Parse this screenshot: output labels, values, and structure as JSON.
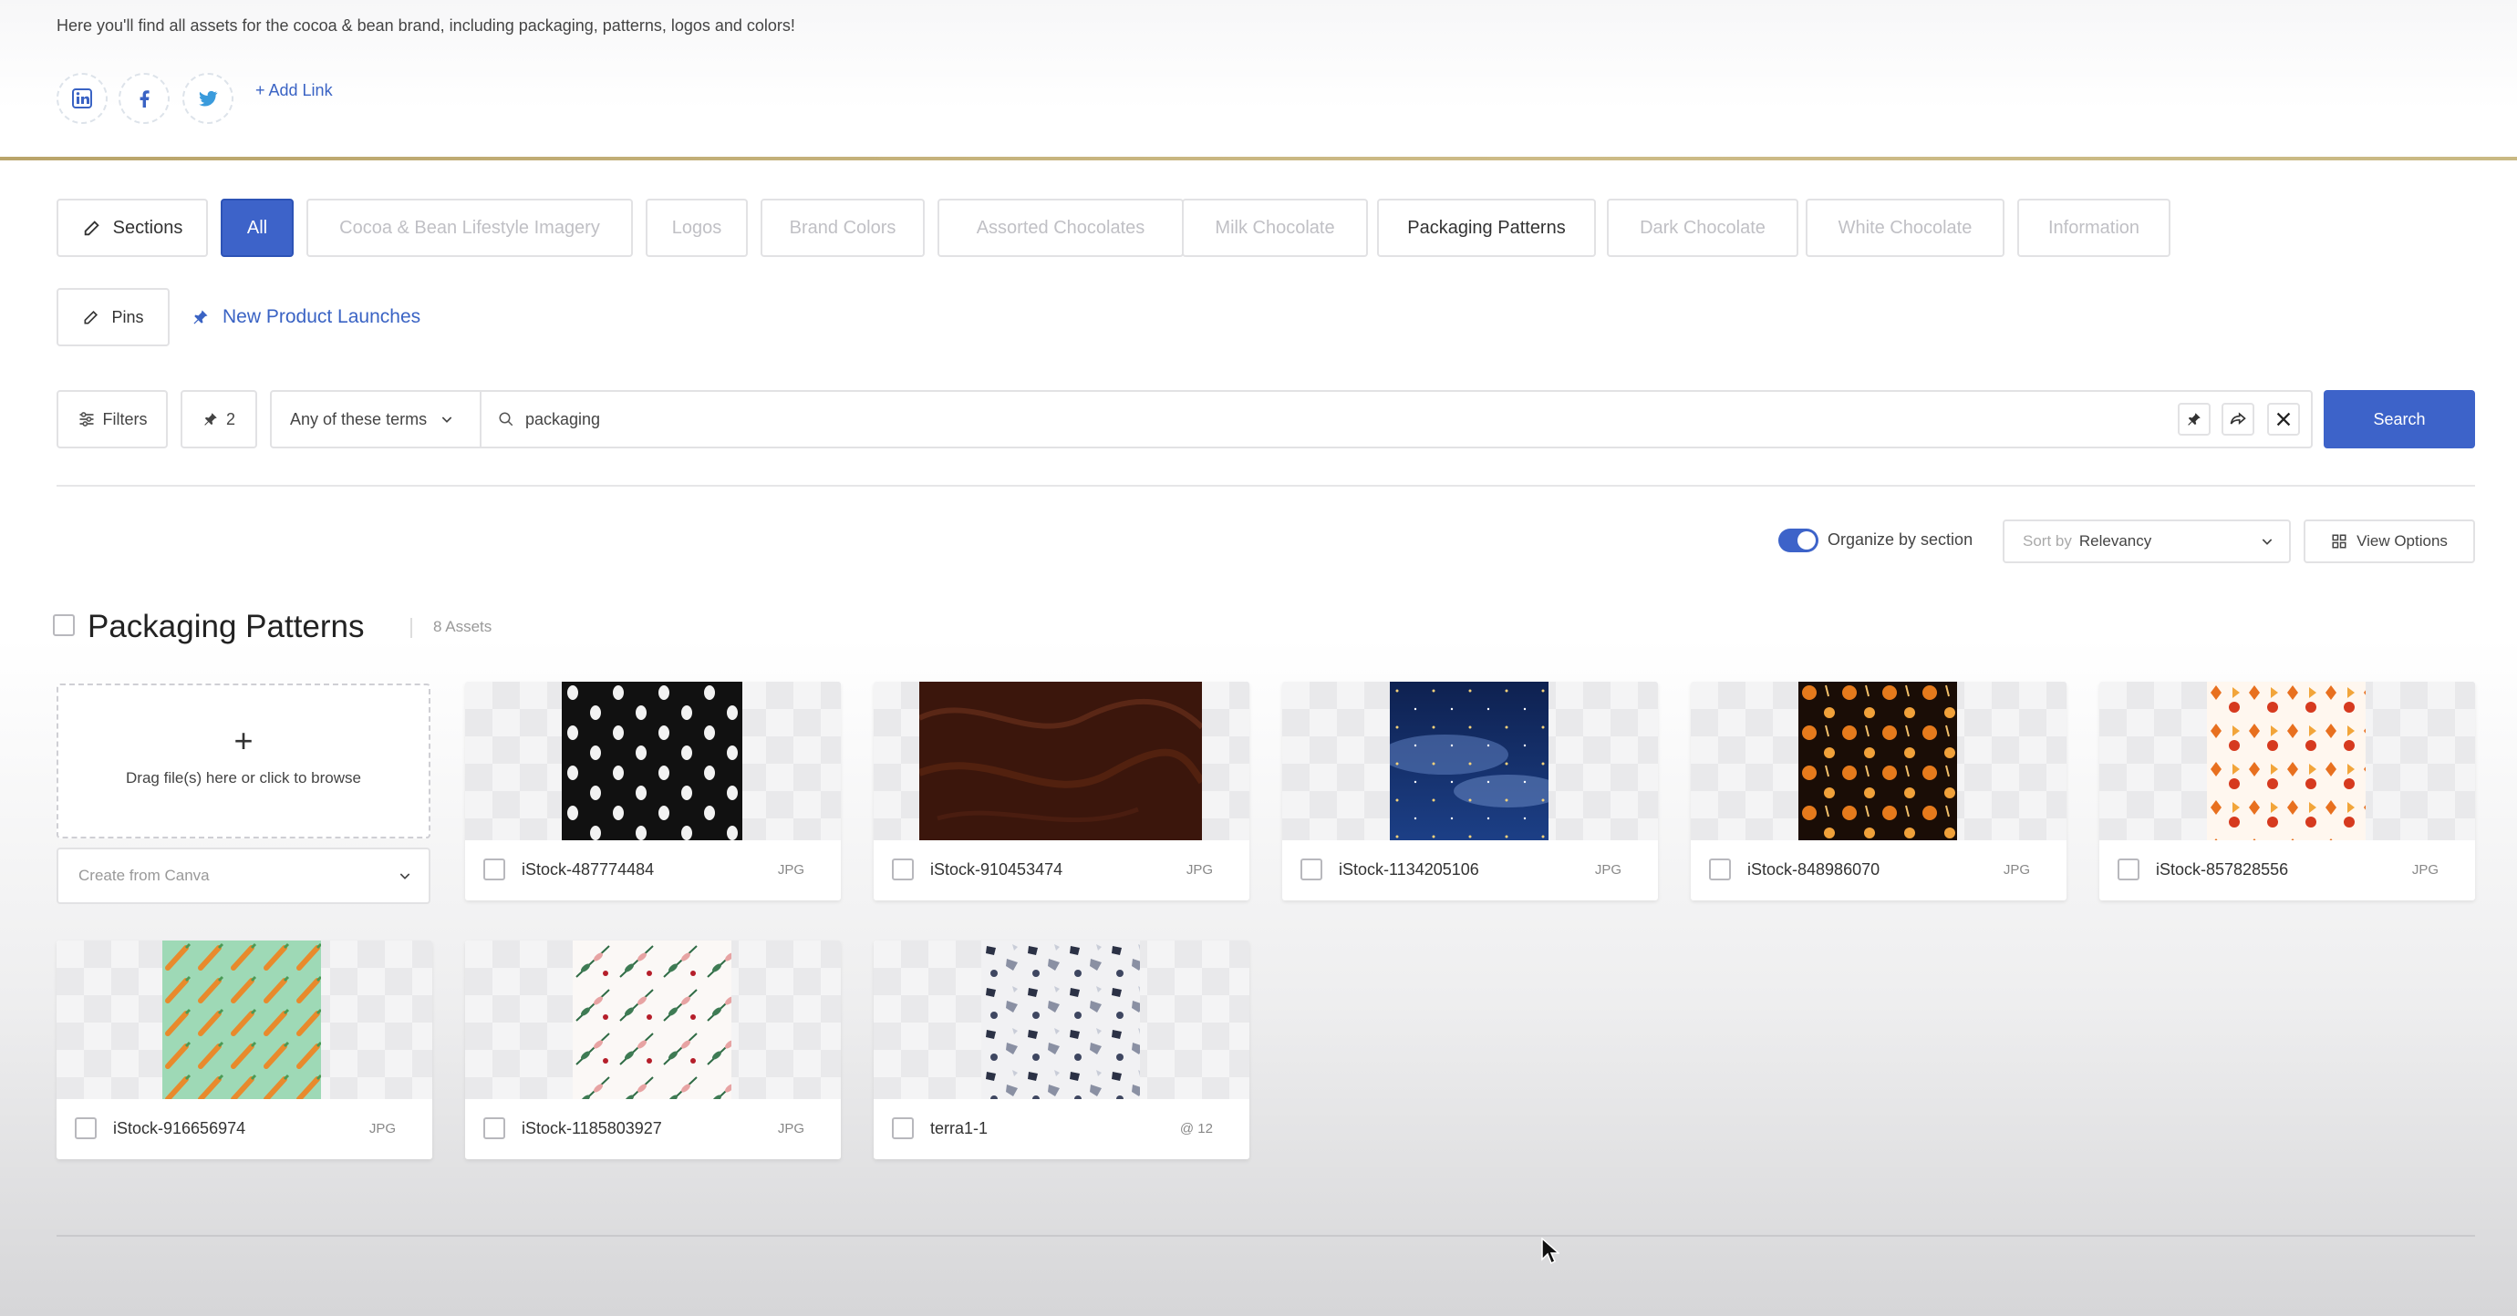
{
  "header": {
    "intro": "Here you'll find all assets for the cocoa & bean brand, including packaging, patterns, logos and colors!",
    "social_icons": [
      "linkedin-icon",
      "facebook-icon",
      "twitter-icon"
    ],
    "add_link": "+ Add Link"
  },
  "sections_bar": {
    "sections_button": "Sections",
    "chips": [
      "All",
      "Cocoa & Bean Lifestyle Imagery",
      "Logos",
      "Brand Colors",
      "Assorted Chocolates",
      "Milk Chocolate",
      "Packaging Patterns",
      "Dark Chocolate",
      "White Chocolate",
      "Information"
    ],
    "active_chip": "All"
  },
  "pins_bar": {
    "pins_button": "Pins",
    "pinned_link": "New Product Launches"
  },
  "filter_bar": {
    "filters_label": "Filters",
    "pin_count": "2",
    "match_mode": "Any of these terms",
    "search_value": "packaging",
    "search_button": "Search"
  },
  "view_controls": {
    "organize_label": "Organize by section",
    "organize_enabled": true,
    "sort_prefix": "Sort by",
    "sort_value": "Relevancy",
    "view_options": "View Options"
  },
  "section": {
    "title": "Packaging Patterns",
    "count": "8 Assets",
    "upload_hint": "Drag file(s) here or click to browse",
    "canva_label": "Create from Canva",
    "assets": [
      {
        "name": "iStock-487774484",
        "type": "JPG"
      },
      {
        "name": "iStock-910453474",
        "type": "JPG"
      },
      {
        "name": "iStock-1134205106",
        "type": "JPG"
      },
      {
        "name": "iStock-848986070",
        "type": "JPG"
      },
      {
        "name": "iStock-857828556",
        "type": "JPG"
      },
      {
        "name": "iStock-916656974",
        "type": "JPG"
      },
      {
        "name": "iStock-1185803927",
        "type": "JPG"
      },
      {
        "name": "terra1-1",
        "type": "@ 12"
      }
    ]
  },
  "colors": {
    "accent": "#3d63c9",
    "divider_gold": "#c2b07a"
  }
}
